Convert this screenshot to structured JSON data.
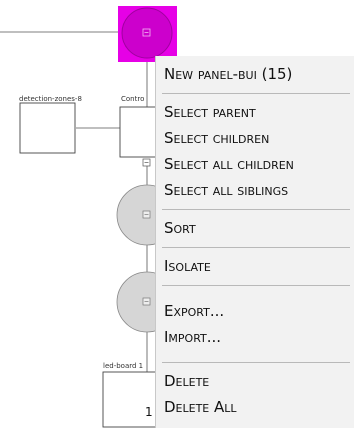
{
  "canvas": {
    "highlight_color": "#e600e6",
    "node_labels": {
      "detection_zones": "detection-zones-8",
      "controller": "Contro",
      "led_board": "led-board 1",
      "led_board_count": "1"
    }
  },
  "context_menu": {
    "items": [
      {
        "key": "new_panel",
        "label": "New panel-bui (15)"
      },
      {
        "key": "select_parent",
        "label": "Select parent"
      },
      {
        "key": "select_children",
        "label": "Select children"
      },
      {
        "key": "select_all_children",
        "label": "Select all children"
      },
      {
        "key": "select_all_siblings",
        "label": "Select all siblings"
      },
      {
        "key": "sort",
        "label": "Sort"
      },
      {
        "key": "isolate",
        "label": "Isolate"
      },
      {
        "key": "export",
        "label": "Export..."
      },
      {
        "key": "import",
        "label": "Import..."
      },
      {
        "key": "delete",
        "label": "Delete"
      },
      {
        "key": "delete_all",
        "label": "Delete All"
      }
    ]
  }
}
